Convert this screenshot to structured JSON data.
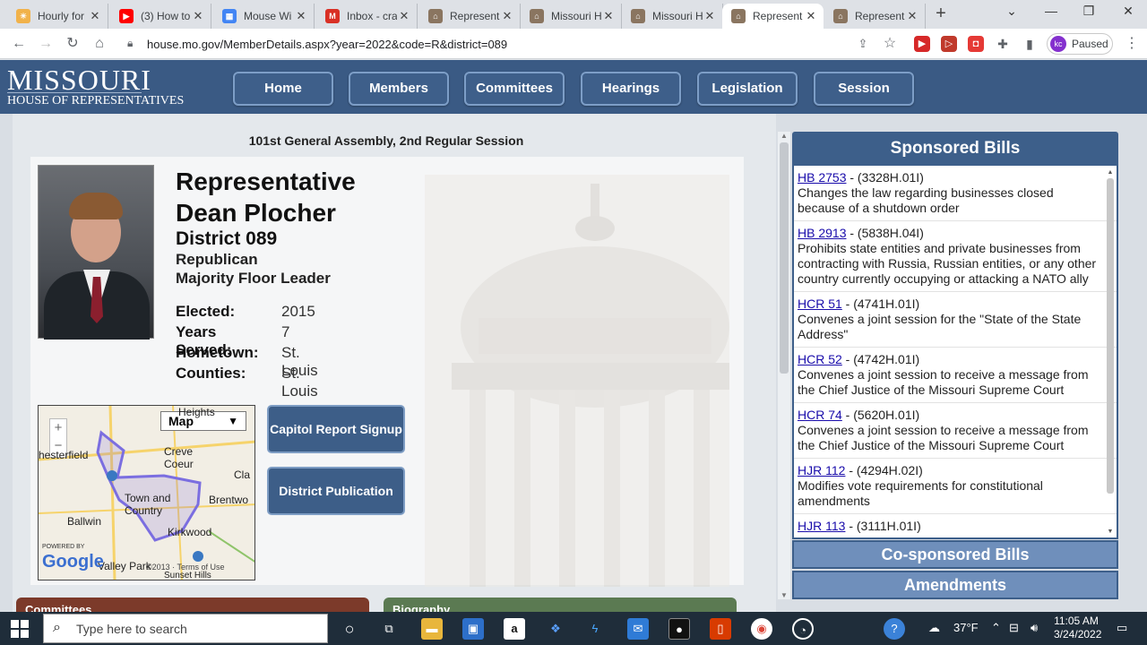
{
  "browser": {
    "tabs": [
      {
        "label": "Hourly for",
        "color": "#f1b24a",
        "glyph": "☀"
      },
      {
        "label": "(3) How to",
        "color": "#ff0000",
        "glyph": "▶"
      },
      {
        "label": "Mouse Wi",
        "color": "#4285f4",
        "glyph": "▦"
      },
      {
        "label": "Inbox - cra",
        "color": "#d93025",
        "glyph": "M"
      },
      {
        "label": "Represent",
        "color": "#8a7560",
        "glyph": "⌂"
      },
      {
        "label": "Missouri H",
        "color": "#8a7560",
        "glyph": "⌂"
      },
      {
        "label": "Missouri H",
        "color": "#8a7560",
        "glyph": "⌂"
      },
      {
        "label": "Represent",
        "color": "#8a7560",
        "glyph": "⌂"
      },
      {
        "label": "Represent",
        "color": "#8a7560",
        "glyph": "⌂"
      }
    ],
    "url": "house.mo.gov/MemberDetails.aspx?year=2022&code=R&district=089",
    "profile_initials": "kc",
    "profile_status": "Paused"
  },
  "site": {
    "logo_line1": "MISSOURI",
    "logo_line2": "HOUSE OF REPRESENTATIVES",
    "nav": [
      "Home",
      "Members",
      "Committees",
      "Hearings",
      "Legislation",
      "Session"
    ]
  },
  "member": {
    "session": "101st General Assembly, 2nd Regular Session",
    "title_line1": "Representative",
    "title_line2": "Dean Plocher",
    "district": "District 089",
    "party": "Republican",
    "role": "Majority Floor Leader",
    "facts": [
      {
        "label": "Elected:",
        "value": "2015"
      },
      {
        "label": "Years Served:",
        "value": "7"
      },
      {
        "label": "Hometown:",
        "value": "St. Louis"
      },
      {
        "label": "Counties:",
        "value": "St. Louis"
      }
    ]
  },
  "map": {
    "type_select": "Map",
    "zoom_in": "+",
    "zoom_out": "−",
    "labels": {
      "heights": "Heights",
      "chesterfield": "hesterfield",
      "creve_coeur": "Creve Coeur",
      "clayton": "Cla",
      "town_country": "Town and Country",
      "brentwood": "Brentwo",
      "ballwin": "Ballwin",
      "kirkwood": "Kirkwood",
      "valley_park": "Valley Park",
      "sunset_hills": "Sunset Hills",
      "powered_by": "POWERED BY",
      "google": "Google",
      "terms": "©2013 · Terms of Use"
    }
  },
  "buttons": {
    "capitol_report": "Capitol Report Signup",
    "district_pub": "District Publication"
  },
  "sections": {
    "committees": "Committees",
    "biography": "Biography"
  },
  "bills_panel": {
    "title": "Sponsored Bills",
    "bills": [
      {
        "id": "HB 2753",
        "code": " - (3328H.01I)",
        "desc": "Changes the law regarding businesses closed because of a shutdown order"
      },
      {
        "id": "HB 2913",
        "code": " - (5838H.04I)",
        "desc": "Prohibits state entities and private businesses from contracting with Russia, Russian entities, or any other country currently occupying or attacking a NATO ally"
      },
      {
        "id": "HCR 51",
        "code": " - (4741H.01I)",
        "desc": "Convenes a joint session for the \"State of the State Address\""
      },
      {
        "id": "HCR 52",
        "code": " - (4742H.01I)",
        "desc": "Convenes a joint session to receive a message from the Chief Justice of the Missouri Supreme Court"
      },
      {
        "id": "HCR 74",
        "code": " - (5620H.01I)",
        "desc": "Convenes a joint session to receive a message from the Chief Justice of the Missouri Supreme Court"
      },
      {
        "id": "HJR 112",
        "code": " - (4294H.02I)",
        "desc": "Modifies vote requirements for constitutional amendments"
      },
      {
        "id": "HJR 113",
        "code": " - (3111H.01I)",
        "desc": ""
      }
    ],
    "cosponsored_title": "Co-sponsored Bills",
    "amendments_title": "Amendments"
  },
  "taskbar": {
    "search_placeholder": "Type here to search",
    "temperature": "37°F",
    "time": "11:05 AM",
    "date": "3/24/2022"
  },
  "colors": {
    "header_blue": "#3a5a84",
    "nav_button": "#3e5f8a",
    "link": "#1a0dab",
    "committees_bar": "#7c3a2a",
    "biography_bar": "#5b7a52"
  }
}
